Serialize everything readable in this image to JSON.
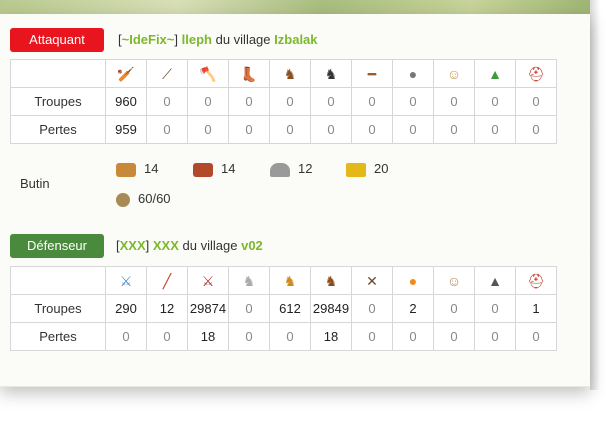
{
  "attacker": {
    "role_label": "Attaquant",
    "player": {
      "prefix_bracket_open": "[",
      "tag": "~IdeFix~",
      "prefix_bracket_close": "]",
      "name": "lleph",
      "mid_text": "du village",
      "village": "Izbalak"
    },
    "unit_icons": [
      "club-icon",
      "spear-icon",
      "axe-icon",
      "scout-boot-icon",
      "horse-icon",
      "dark-horse-icon",
      "ram-icon",
      "catapult-icon",
      "chief-icon",
      "settler-hat-icon",
      "hero-helmet-icon"
    ],
    "rows": [
      {
        "label": "Troupes",
        "values": [
          "960",
          "0",
          "0",
          "0",
          "0",
          "0",
          "0",
          "0",
          "0",
          "0",
          "0"
        ]
      },
      {
        "label": "Pertes",
        "values": [
          "959",
          "0",
          "0",
          "0",
          "0",
          "0",
          "0",
          "0",
          "0",
          "0",
          "0"
        ]
      }
    ]
  },
  "loot": {
    "label": "Butin",
    "resources": [
      {
        "icon": "wood-icon",
        "value": "14",
        "color": "#c8893a"
      },
      {
        "icon": "clay-icon",
        "value": "14",
        "color": "#b04a2a"
      },
      {
        "icon": "iron-icon",
        "value": "12",
        "color": "#9a9a9a"
      },
      {
        "icon": "crop-icon",
        "value": "20",
        "color": "#e5b81a"
      }
    ],
    "capacity": {
      "icon": "loot-bag-icon",
      "value": "60/60",
      "color": "#a88a55"
    }
  },
  "defender": {
    "role_label": "Défenseur",
    "player": {
      "prefix_bracket_open": "[",
      "tag": "XXX",
      "prefix_bracket_close": "]",
      "name": "XXX",
      "mid_text": "du village",
      "village": "v02"
    },
    "unit_icons": [
      "blue-sword-icon",
      "red-spear-icon",
      "red-sword-icon",
      "white-horse-icon",
      "orange-horse-icon",
      "brown-horse-icon",
      "battering-icon",
      "fire-catapult-icon",
      "senator-icon",
      "settler-icon",
      "hero-helmet-icon"
    ],
    "rows": [
      {
        "label": "Troupes",
        "values": [
          "290",
          "12",
          "29874",
          "0",
          "612",
          "29849",
          "0",
          "2",
          "0",
          "0",
          "1"
        ]
      },
      {
        "label": "Pertes",
        "values": [
          "0",
          "0",
          "18",
          "0",
          "0",
          "18",
          "0",
          "0",
          "0",
          "0",
          "0"
        ]
      }
    ]
  },
  "colors": {
    "attacker_badge": "#e8141e",
    "defender_badge": "#4a8a3c",
    "highlight_green": "#7cb92a"
  }
}
